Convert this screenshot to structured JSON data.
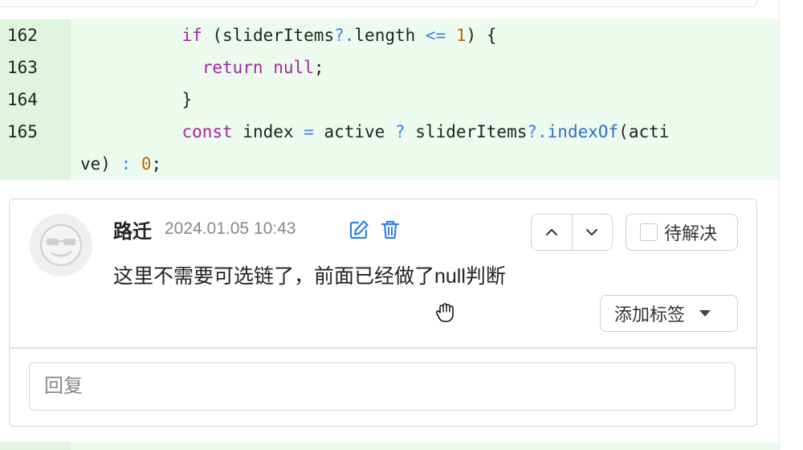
{
  "diff": {
    "lines": [
      {
        "number": "162",
        "indent": "          ",
        "tokens": [
          {
            "t": "if",
            "c": "kw"
          },
          {
            "t": " (sliderItems",
            "c": ""
          },
          {
            "t": "?.",
            "c": "op"
          },
          {
            "t": "length ",
            "c": ""
          },
          {
            "t": "<=",
            "c": "op"
          },
          {
            "t": " ",
            "c": ""
          },
          {
            "t": "1",
            "c": "num"
          },
          {
            "t": ") {",
            "c": ""
          }
        ]
      },
      {
        "number": "163",
        "indent": "            ",
        "tokens": [
          {
            "t": "return",
            "c": "kw"
          },
          {
            "t": " ",
            "c": ""
          },
          {
            "t": "null",
            "c": "kw"
          },
          {
            "t": ";",
            "c": ""
          }
        ]
      },
      {
        "number": "164",
        "indent": "          ",
        "tokens": [
          {
            "t": "}",
            "c": ""
          }
        ]
      },
      {
        "number": "165",
        "indent": "          ",
        "tokens": [
          {
            "t": "const",
            "c": "kw"
          },
          {
            "t": " index ",
            "c": ""
          },
          {
            "t": "=",
            "c": "op"
          },
          {
            "t": " active ",
            "c": ""
          },
          {
            "t": "?",
            "c": "op"
          },
          {
            "t": " sliderItems",
            "c": ""
          },
          {
            "t": "?.",
            "c": "op"
          },
          {
            "t": "indexOf",
            "c": "fn"
          },
          {
            "t": "(acti",
            "c": ""
          }
        ]
      },
      {
        "number": "",
        "indent": "",
        "tokens": [
          {
            "t": "ve) ",
            "c": ""
          },
          {
            "t": ":",
            "c": "op"
          },
          {
            "t": " ",
            "c": ""
          },
          {
            "t": "0",
            "c": "num"
          },
          {
            "t": ";",
            "c": ""
          }
        ]
      }
    ]
  },
  "comment": {
    "author": "路迁",
    "timestamp": "2024.01.05 10:43",
    "body": "这里不需要可选链了，前面已经做了null判断",
    "resolve_label": "待解决",
    "tag_label": "添加标签",
    "reply_placeholder": "回复"
  },
  "colors": {
    "diff_bg": "#edfbee",
    "gutter_bg": "#dff5e0",
    "keyword": "#a626a4",
    "operator": "#3b82f6",
    "number": "#b07000",
    "icon_blue": "#2f80ed"
  }
}
